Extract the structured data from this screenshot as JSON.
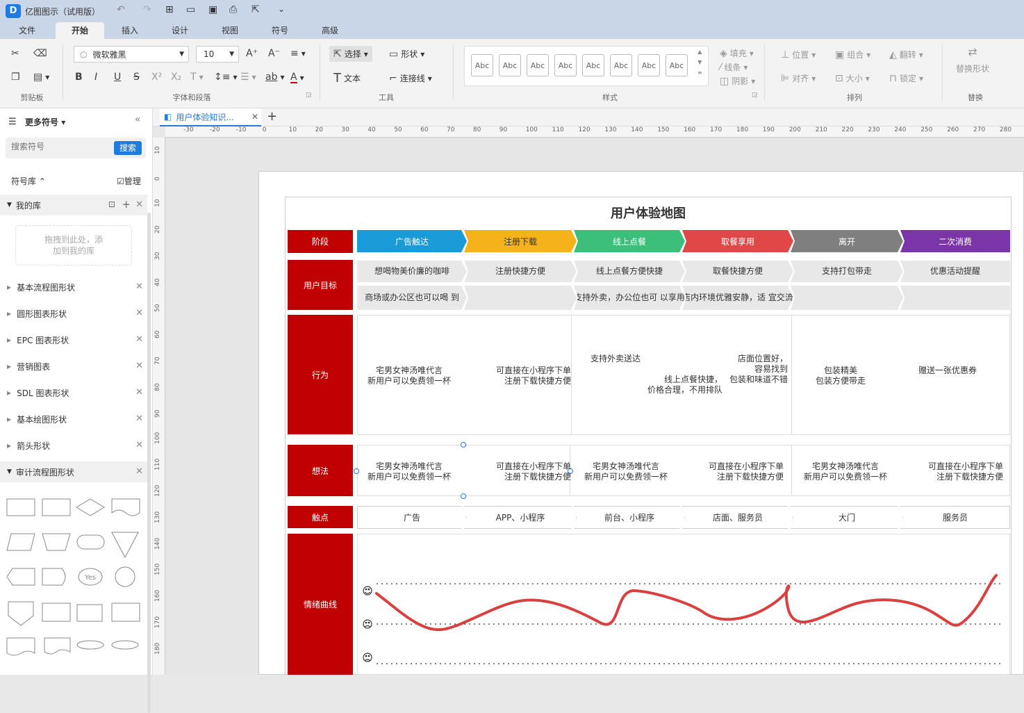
{
  "app": {
    "title": "亿图图示（试用版）"
  },
  "menu": [
    "文件",
    "开始",
    "插入",
    "设计",
    "视图",
    "符号",
    "高级"
  ],
  "ribbon": {
    "font_name": "微软雅黑",
    "font_size": "10",
    "select": "选择",
    "shape": "形状",
    "text": "文本",
    "connector": "连接线",
    "fill": "填充",
    "line": "线条",
    "shadow": "阴影",
    "position": "位置",
    "group": "组合",
    "flip": "翻转",
    "align": "对齐",
    "size": "大小",
    "lock": "锁定",
    "replace": "替换形状",
    "style_sample": "Abc",
    "groups": {
      "clipboard": "剪贴板",
      "font": "字体和段落",
      "tools": "工具",
      "style": "样式",
      "arrange": "排列",
      "replace": "替换"
    }
  },
  "left": {
    "more_symbols": "更多符号",
    "search_placeholder": "搜索符号",
    "search_btn": "搜索",
    "library": "符号库",
    "manage": "管理",
    "my_library": "我的库",
    "drop_hint": "拖拽到此处，添\n加到我的库",
    "libs": [
      "基本流程图形状",
      "圆形图表形状",
      "EPC 图表形状",
      "营销图表",
      "SDL 图表形状",
      "基本绘图形状",
      "箭头形状",
      "审计流程图形状"
    ],
    "yes_label": "Yes"
  },
  "tab": {
    "title": "用户体验知识..."
  },
  "ruler": {
    "h": [
      "-30",
      "-20",
      "-10",
      "0",
      "10",
      "20",
      "30",
      "40",
      "50",
      "60",
      "70",
      "80",
      "90",
      "100",
      "110",
      "120",
      "130",
      "140",
      "150",
      "160",
      "170",
      "180",
      "190",
      "200",
      "210",
      "220",
      "230",
      "240",
      "250",
      "260",
      "270",
      "280"
    ],
    "v": [
      "10",
      "0",
      "10",
      "20",
      "30",
      "40",
      "50",
      "60",
      "70",
      "80",
      "90",
      "100",
      "110",
      "120",
      "130",
      "140",
      "150",
      "160",
      "170",
      "180"
    ]
  },
  "map": {
    "title": "用户体验地图",
    "rows": {
      "stage": "阶段",
      "goal": "用户目标",
      "behavior": "行为",
      "thought": "想法",
      "touch": "触点",
      "emotion": "情绪曲线"
    },
    "stages": [
      {
        "label": "广告触达",
        "color": "#1a9ad6"
      },
      {
        "label": "注册下载",
        "color": "#f6b21a"
      },
      {
        "label": "线上点餐",
        "color": "#3bbf7a"
      },
      {
        "label": "取餐享用",
        "color": "#e04848"
      },
      {
        "label": "离开",
        "color": "#7f7f7f"
      },
      {
        "label": "二次消费",
        "color": "#7b35a8"
      }
    ],
    "goals_top": [
      "想喝物美价廉的咖啡",
      "注册快捷方便",
      "线上点餐方便快捷",
      "取餐快捷方便",
      "支持打包带走",
      "优惠活动提醒"
    ],
    "goals_bottom": [
      "商场或办公区也可以喝\n到",
      "",
      "支持外卖，办公位也可\n以享用",
      "店内环境优雅安静，适\n宜交流",
      "",
      ""
    ],
    "behaviors": [
      "宅男女神汤唯代言\n新用户可以免费领一杯",
      "可直接在小程序下单\n注册下载快捷方便",
      "支持外卖送达",
      "店面位置好，\n容易找到\n包装和味道不错",
      "线上点餐快捷，\n价格合理，不用排队",
      "包装精美\n包装方便带走",
      "赠送一张优惠券"
    ],
    "thoughts": [
      "宅男女神汤唯代言\n新用户可以免费领一杯",
      "可直接在小程序下单\n注册下载快捷方便",
      "宅男女神汤唯代言\n新用户可以免费领一杯",
      "可直接在小程序下单\n注册下载快捷方便",
      "宅男女神汤唯代言\n新用户可以免费领一杯",
      "可直接在小程序下单\n注册下载快捷方便"
    ],
    "touchpoints": [
      "广告",
      "APP、小程序",
      "前台、小程序",
      "店面、服务员",
      "大门",
      "服务员"
    ],
    "faces": [
      "happy-face",
      "neutral-face",
      "sad-face"
    ]
  }
}
